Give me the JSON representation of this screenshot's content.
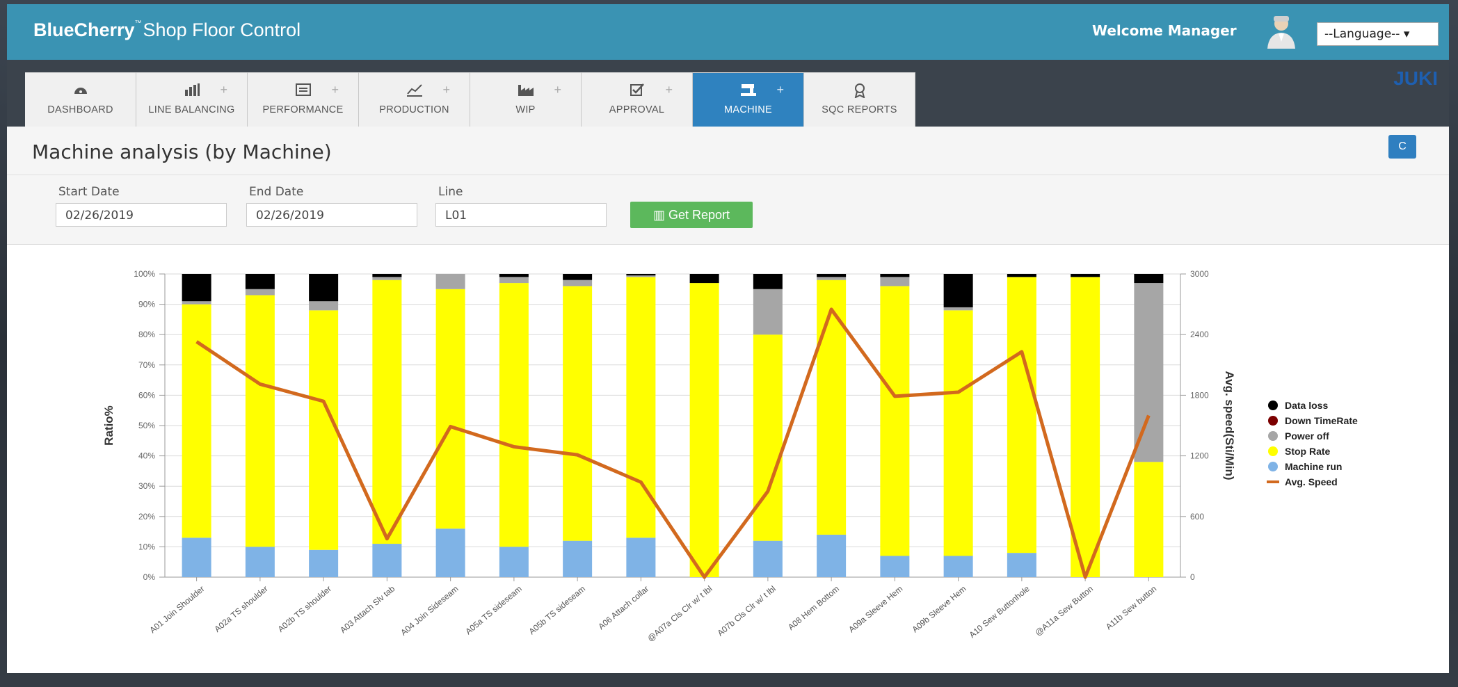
{
  "header": {
    "brand_bold": "BlueCherry",
    "brand_rest": "Shop Floor Control",
    "welcome": "Welcome Manager",
    "language": "--Language-- ▾",
    "logo_text": "JUKI"
  },
  "tabs": [
    {
      "label": "DASHBOARD",
      "icon": "dashboard-icon",
      "plus": ""
    },
    {
      "label": "LINE BALANCING",
      "icon": "bar-chart-icon",
      "plus": "+"
    },
    {
      "label": "PERFORMANCE",
      "icon": "list-icon",
      "plus": "+"
    },
    {
      "label": "PRODUCTION",
      "icon": "line-chart-icon",
      "plus": "+"
    },
    {
      "label": "WIP",
      "icon": "factory-icon",
      "plus": "+"
    },
    {
      "label": "APPROVAL",
      "icon": "checkbox-icon",
      "plus": "+"
    },
    {
      "label": "MACHINE",
      "icon": "machine-icon",
      "plus": "+"
    },
    {
      "label": "SQC REPORTS",
      "icon": "award-icon",
      "plus": ""
    }
  ],
  "page": {
    "title": "Machine analysis (by Machine)",
    "refresh_icon": "C"
  },
  "filters": {
    "start_label": "Start Date",
    "start_value": "02/26/2019",
    "end_label": "End Date",
    "end_value": "02/26/2019",
    "line_label": "Line",
    "line_value": "L01",
    "button_label": "Get Report"
  },
  "colors": {
    "header": "#3a93b3",
    "active_tab": "#2f82bf",
    "machine_run": "#7fb3e6",
    "stop_rate": "#ffff00",
    "power_off": "#a6a6a6",
    "down_time": "#7b0000",
    "data_loss": "#000000",
    "avg_speed": "#d2691e"
  },
  "chart_data": {
    "type": "bar",
    "stacked": true,
    "categories": [
      "A01 Join Shoulder",
      "A02a TS shoulder",
      "A02b TS shoulder",
      "A03 Attach Slv tab",
      "A04 Join Sideseam",
      "A05a TS sideseam",
      "A05b TS sideseam",
      "A06 Attach collar",
      "@A07a Cls Clr w/ t lbl",
      "A07b Cls Clr w/ t lbl",
      "A08 Hem Bottom",
      "A09a Sleeve Hem",
      "A09b Sleeve Hem",
      "A10 Sew Buttonhole",
      "@A11a Sew Button",
      "A11b Sew button"
    ],
    "series": [
      {
        "name": "Machine run",
        "values": [
          13,
          10,
          9,
          11,
          16,
          10,
          12,
          13,
          0,
          12,
          14,
          7,
          7,
          8,
          0,
          0
        ]
      },
      {
        "name": "Stop Rate",
        "values": [
          77,
          83,
          79,
          87,
          79,
          87,
          84,
          86,
          97,
          68,
          84,
          89,
          81,
          91,
          99,
          38
        ]
      },
      {
        "name": "Power off",
        "values": [
          1,
          2,
          3,
          1,
          5,
          2,
          2,
          0.5,
          0,
          15,
          1,
          3,
          1,
          0,
          0,
          59
        ]
      },
      {
        "name": "Down TimeRate",
        "values": [
          0,
          0,
          0,
          0,
          0,
          0,
          0,
          0,
          0,
          0,
          0,
          0,
          0,
          0,
          0,
          0
        ]
      },
      {
        "name": "Data loss",
        "values": [
          9,
          5,
          9,
          1,
          0,
          1,
          2,
          0.5,
          3,
          5,
          1,
          1,
          11,
          1,
          1,
          3
        ]
      },
      {
        "name": "Avg. Speed",
        "type": "line",
        "axis": "right",
        "values": [
          2330,
          1910,
          1740,
          380,
          1490,
          1290,
          1210,
          940,
          0,
          850,
          2650,
          1790,
          1830,
          2230,
          0,
          1600
        ]
      }
    ],
    "ylabel": "Ratio%",
    "y2label": "Avg. speed(Sti/Min)",
    "ylim": [
      0,
      100
    ],
    "y2lim": [
      0,
      3000
    ],
    "yticks": [
      "0%",
      "10%",
      "20%",
      "30%",
      "40%",
      "50%",
      "60%",
      "70%",
      "80%",
      "90%",
      "100%"
    ],
    "y2ticks": [
      "0",
      "600",
      "1200",
      "1800",
      "2400",
      "3000"
    ],
    "legend_order": [
      "Data loss",
      "Down TimeRate",
      "Power off",
      "Stop Rate",
      "Machine run",
      "Avg. Speed"
    ],
    "legend_position": "right"
  }
}
